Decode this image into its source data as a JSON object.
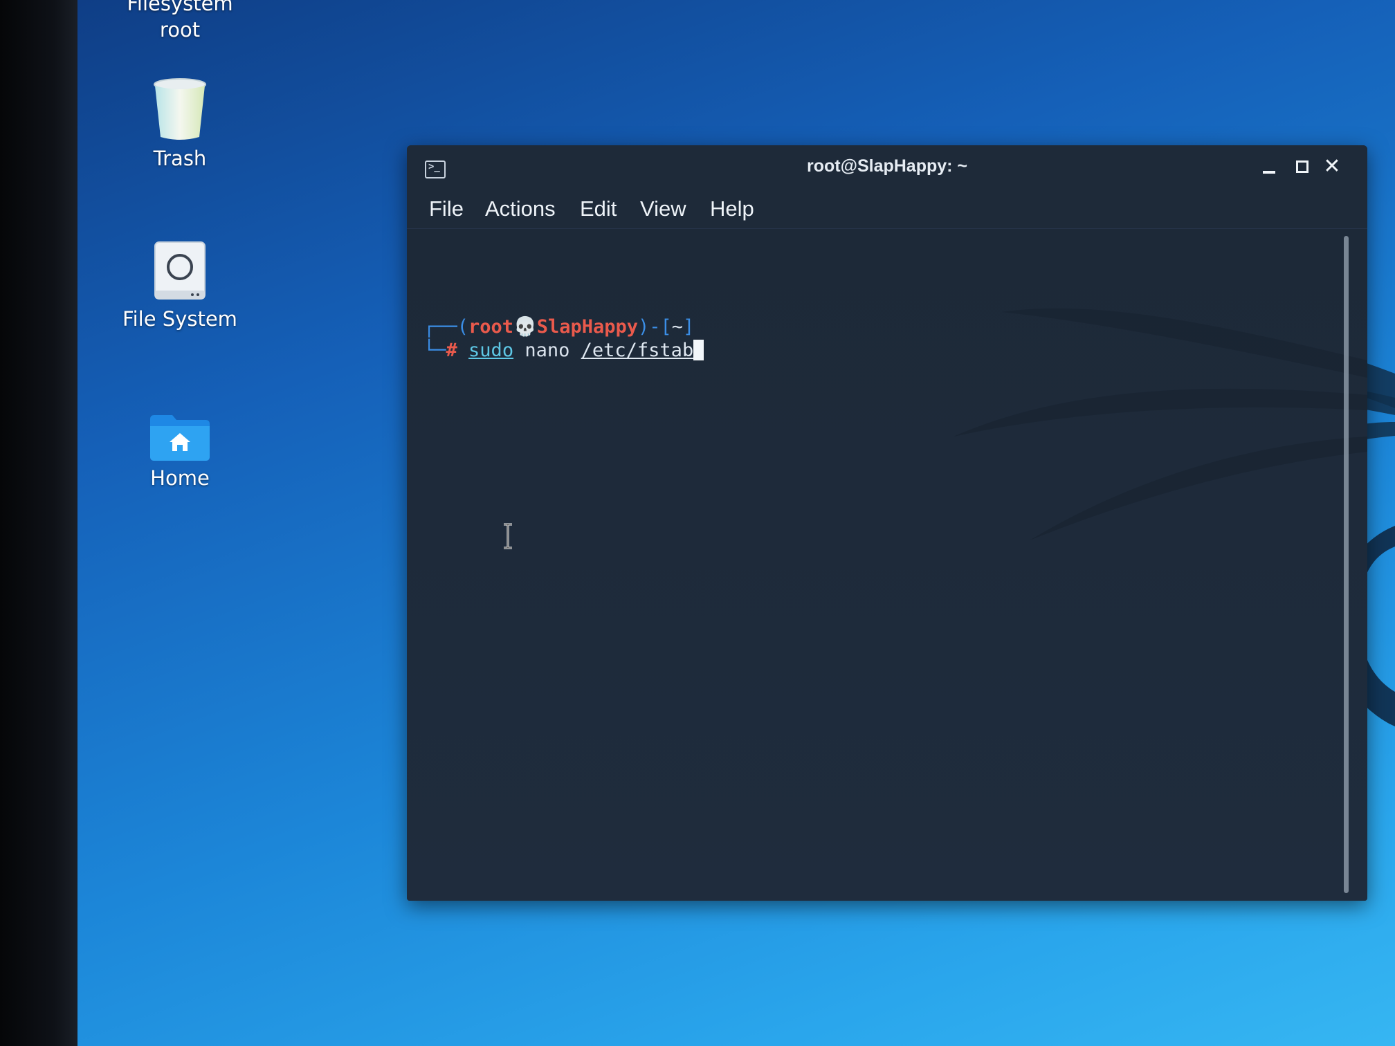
{
  "desktop": {
    "icons": [
      {
        "label_line1": "Filesystem",
        "label_line2": "root"
      },
      {
        "label": "Trash"
      },
      {
        "label": "File System"
      },
      {
        "label": "Home"
      }
    ]
  },
  "terminal": {
    "title": "root@SlapHappy: ~",
    "menu": [
      "File",
      "Actions",
      "Edit",
      "View",
      "Help"
    ],
    "prompt": {
      "user": "root",
      "host": "SlapHappy",
      "dir": "~",
      "symbol": "#"
    },
    "command": {
      "sudo": "sudo",
      "program": "nano",
      "path": "/etc/fstab"
    }
  },
  "colors": {
    "accent": "#3b8ee6",
    "prompt_user": "#ea5a4c",
    "command_highlight": "#5ec8e6",
    "terminal_bg": "#1f2b3b"
  }
}
